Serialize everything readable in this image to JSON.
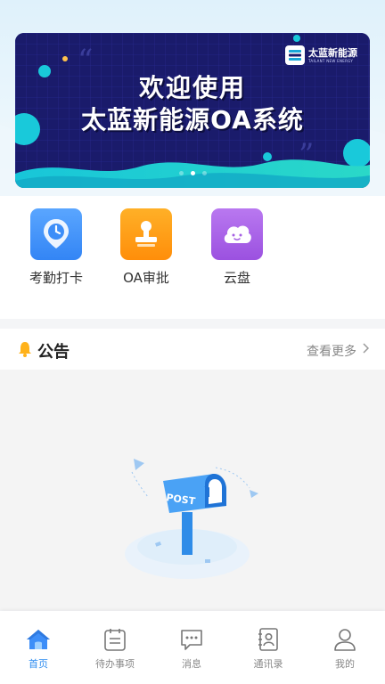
{
  "banner": {
    "title_line1": "欢迎使用",
    "title_line2": "太蓝新能源OA系统",
    "logo_text": "太蓝新能源",
    "logo_subtext": "TAILANT NEW ENERGY",
    "slides": 3,
    "active_slide": 2
  },
  "apps": [
    {
      "label": "考勤打卡",
      "icon": "location-pin-icon",
      "color": "#3d8ef8"
    },
    {
      "label": "OA审批",
      "icon": "stamp-icon",
      "color": "#ff9b16"
    },
    {
      "label": "云盘",
      "icon": "cloud-icon",
      "color": "#a55fe3"
    }
  ],
  "notice": {
    "title": "公告",
    "more_label": "查看更多"
  },
  "empty_state": {
    "mailbox_text": "POST"
  },
  "tabs": [
    {
      "label": "首页",
      "icon": "home-icon",
      "active": true
    },
    {
      "label": "待办事项",
      "icon": "todo-list-icon",
      "active": false
    },
    {
      "label": "消息",
      "icon": "message-icon",
      "active": false
    },
    {
      "label": "通讯录",
      "icon": "contacts-icon",
      "active": false
    },
    {
      "label": "我的",
      "icon": "profile-icon",
      "active": false
    }
  ],
  "colors": {
    "accent": "#2d8cf0",
    "banner_bg": "#1a1b6b"
  }
}
